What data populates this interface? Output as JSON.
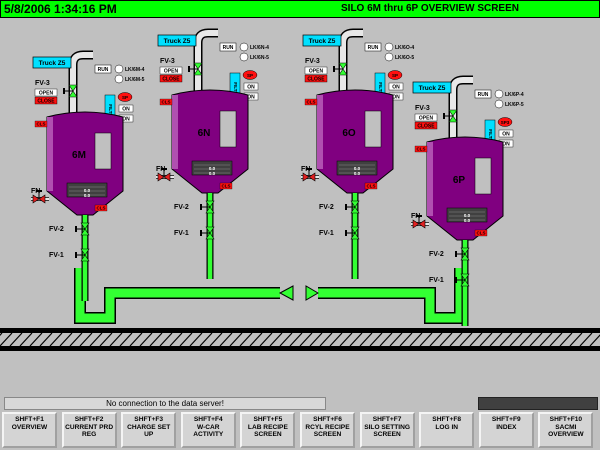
{
  "header": {
    "datetime": "5/8/2006  1:34:16 PM",
    "title": "SILO 6M thru 6P OVERVIEW SCREEN"
  },
  "common": {
    "truck": "Truck Z5",
    "run": "RUN",
    "on": "ON",
    "open": "OPEN",
    "close": "CLOSE",
    "filter": "FILTER",
    "fn": "FN",
    "fv1": "FV-1",
    "fv2": "FV-2",
    "fv3": "FV-3",
    "cls": "CLS",
    "fill": "0.0"
  },
  "silos": [
    {
      "label": "6M",
      "lk_top": "LK/6M-4",
      "lk_bot": "LK/6M-5",
      "sp": "SP"
    },
    {
      "label": "6N",
      "lk_top": "LK/6N-4",
      "lk_bot": "LK/6N-5",
      "sp": "SP"
    },
    {
      "label": "6O",
      "lk_top": "LK/6O-4",
      "lk_bot": "LK/6O-5",
      "sp": "SP"
    },
    {
      "label": "6P",
      "lk_top": "LK/6P-4",
      "lk_bot": "LK/6P-5",
      "sp": "SP3"
    }
  ],
  "status": {
    "message": "No connection to the data server!"
  },
  "fkeys": [
    {
      "key": "SHFT+F1",
      "label": "OVERVIEW"
    },
    {
      "key": "SHFT+F2",
      "label": "CURRENT PRD REG"
    },
    {
      "key": "SHFT+F3",
      "label": "CHARGE SET UP"
    },
    {
      "key": "SHFT+F4",
      "label": "W-CAR ACTIVITY"
    },
    {
      "key": "SHFT+F5",
      "label": "LAB RECIPE SCREEN"
    },
    {
      "key": "SHFT+F6",
      "label": "RCYL RECIPE SCREEN"
    },
    {
      "key": "SHFT+F7",
      "label": "SILO SETTING SCREEN"
    },
    {
      "key": "SHFT+F8",
      "label": "LOG IN"
    },
    {
      "key": "SHFT+F9",
      "label": "INDEX"
    },
    {
      "key": "SHFT+F10",
      "label": "SACMI OVERVIEW"
    }
  ]
}
